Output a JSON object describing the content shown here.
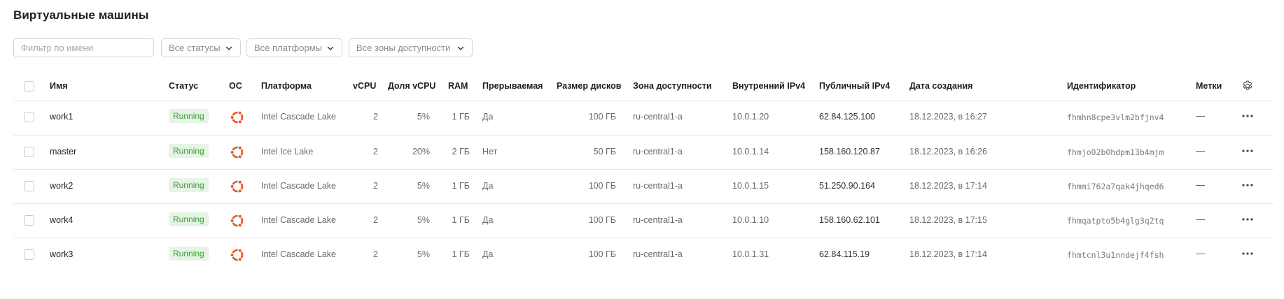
{
  "page": {
    "title": "Виртуальные машины"
  },
  "filters": {
    "name_placeholder": "Фильтр по имени",
    "status": "Все статусы",
    "platform": "Все платформы",
    "zone": "Все зоны доступности"
  },
  "columns": {
    "name": "Имя",
    "status": "Статус",
    "os": "ОС",
    "platform": "Платформа",
    "vcpu": "vCPU",
    "vcpu_share": "Доля vCPU",
    "ram": "RAM",
    "preemptible": "Прерываемая",
    "disk_size": "Размер дисков",
    "zone": "Зона доступности",
    "internal_ip": "Внутренний IPv4",
    "public_ip": "Публичный IPv4",
    "created": "Дата создания",
    "id": "Идентификатор",
    "labels": "Метки"
  },
  "rows": [
    {
      "name": "work1",
      "status": "Running",
      "os_icon": "ubuntu-icon",
      "platform": "Intel Cascade Lake",
      "vcpu": "2",
      "vcpu_share": "5%",
      "ram": "1 ГБ",
      "preemptible": "Да",
      "disk_size": "100 ГБ",
      "zone": "ru-central1-a",
      "internal_ip": "10.0.1.20",
      "public_ip": "62.84.125.100",
      "created": "18.12.2023, в 16:27",
      "id": "fhmhn8cpe3vlm2bfjnv4",
      "labels": "—"
    },
    {
      "name": "master",
      "status": "Running",
      "os_icon": "ubuntu-icon",
      "platform": "Intel Ice Lake",
      "vcpu": "2",
      "vcpu_share": "20%",
      "ram": "2 ГБ",
      "preemptible": "Нет",
      "disk_size": "50 ГБ",
      "zone": "ru-central1-a",
      "internal_ip": "10.0.1.14",
      "public_ip": "158.160.120.87",
      "created": "18.12.2023, в 16:26",
      "id": "fhmjo02b0hdpm13b4mjm",
      "labels": "—"
    },
    {
      "name": "work2",
      "status": "Running",
      "os_icon": "ubuntu-icon",
      "platform": "Intel Cascade Lake",
      "vcpu": "2",
      "vcpu_share": "5%",
      "ram": "1 ГБ",
      "preemptible": "Да",
      "disk_size": "100 ГБ",
      "zone": "ru-central1-a",
      "internal_ip": "10.0.1.15",
      "public_ip": "51.250.90.164",
      "created": "18.12.2023, в 17:14",
      "id": "fhmmi762a7qak4jhqed6",
      "labels": "—"
    },
    {
      "name": "work4",
      "status": "Running",
      "os_icon": "ubuntu-icon",
      "platform": "Intel Cascade Lake",
      "vcpu": "2",
      "vcpu_share": "5%",
      "ram": "1 ГБ",
      "preemptible": "Да",
      "disk_size": "100 ГБ",
      "zone": "ru-central1-a",
      "internal_ip": "10.0.1.10",
      "public_ip": "158.160.62.101",
      "created": "18.12.2023, в 17:15",
      "id": "fhmqatpto5b4glg3q2tq",
      "labels": "—"
    },
    {
      "name": "work3",
      "status": "Running",
      "os_icon": "ubuntu-icon",
      "platform": "Intel Cascade Lake",
      "vcpu": "2",
      "vcpu_share": "5%",
      "ram": "1 ГБ",
      "preemptible": "Да",
      "disk_size": "100 ГБ",
      "zone": "ru-central1-a",
      "internal_ip": "10.0.1.31",
      "public_ip": "62.84.115.19",
      "created": "18.12.2023, в 17:14",
      "id": "fhmtcnl3u1nndejf4fsh",
      "labels": "—"
    }
  ],
  "colors": {
    "status_bg": "#e5f4e4",
    "status_text": "#3d9a37",
    "ubuntu": "#e95420"
  }
}
